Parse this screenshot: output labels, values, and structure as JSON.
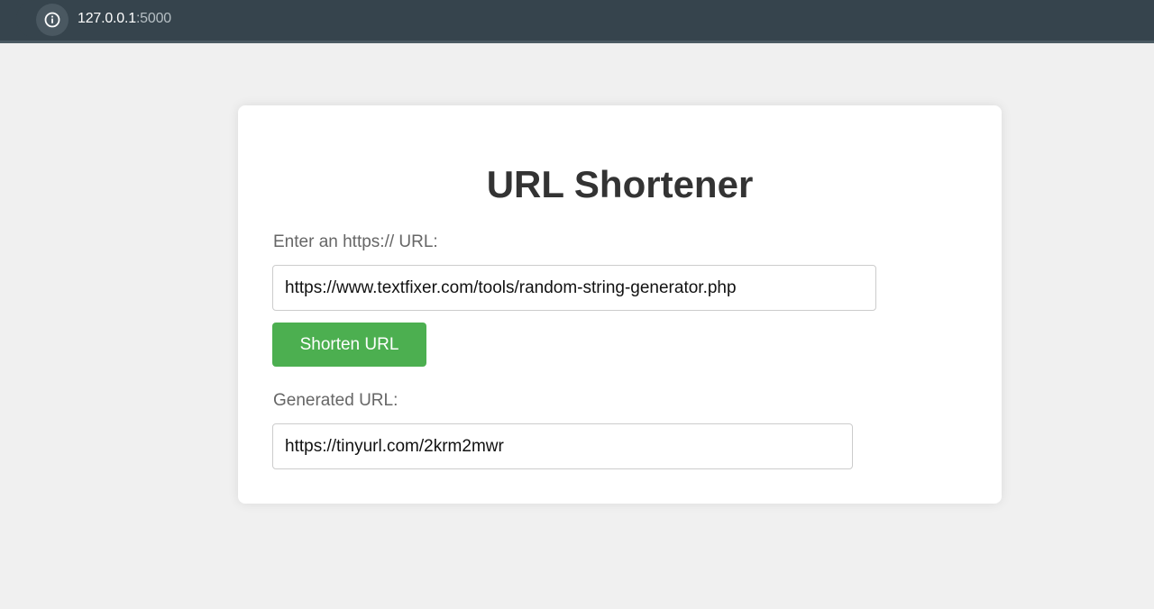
{
  "browser": {
    "host": "127.0.0.1",
    "port": ":5000",
    "site_info_icon": "info-circle-icon"
  },
  "page": {
    "title": "URL Shortener",
    "input_label": "Enter an https:// URL:",
    "input_value": "https://www.textfixer.com/tools/random-string-generator.php",
    "button_label": "Shorten URL",
    "output_label": "Generated URL:",
    "output_value": "https://tinyurl.com/2krm2mwr"
  },
  "colors": {
    "topbar": "#36444d",
    "button": "#4caf50",
    "background": "#f0f0f0"
  }
}
